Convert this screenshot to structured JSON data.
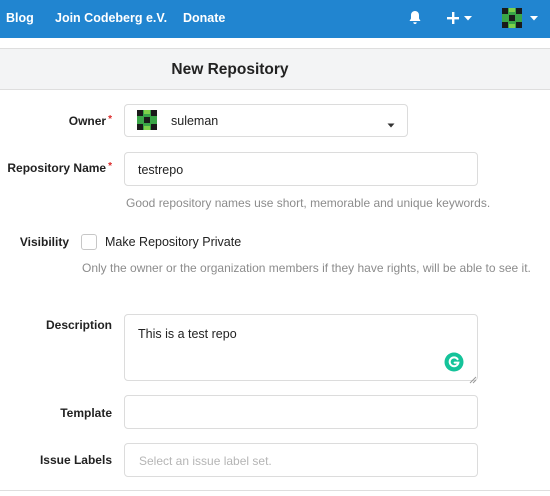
{
  "nav": {
    "links": [
      "Blog",
      "Join Codeberg e.V.",
      "Donate"
    ],
    "icons": {
      "notifications": "bell-icon",
      "create": "plus-icon",
      "dropdown": "caret-down-icon"
    },
    "accent_color": "#2185d0"
  },
  "form": {
    "title": "New Repository",
    "owner": {
      "label": "Owner",
      "required_mark": "*",
      "value": "suleman"
    },
    "repo_name": {
      "label": "Repository Name",
      "required_mark": "*",
      "value": "testrepo",
      "help": "Good repository names use short, memorable and unique keywords."
    },
    "visibility": {
      "label": "Visibility",
      "checkbox_label": "Make Repository Private",
      "checked": false,
      "help": "Only the owner or the organization members if they have rights, will be able to see it."
    },
    "description": {
      "label": "Description",
      "value": "This is a test repo"
    },
    "template": {
      "label": "Template",
      "value": ""
    },
    "issue_labels": {
      "label": "Issue Labels",
      "placeholder": "Select an issue label set."
    }
  }
}
